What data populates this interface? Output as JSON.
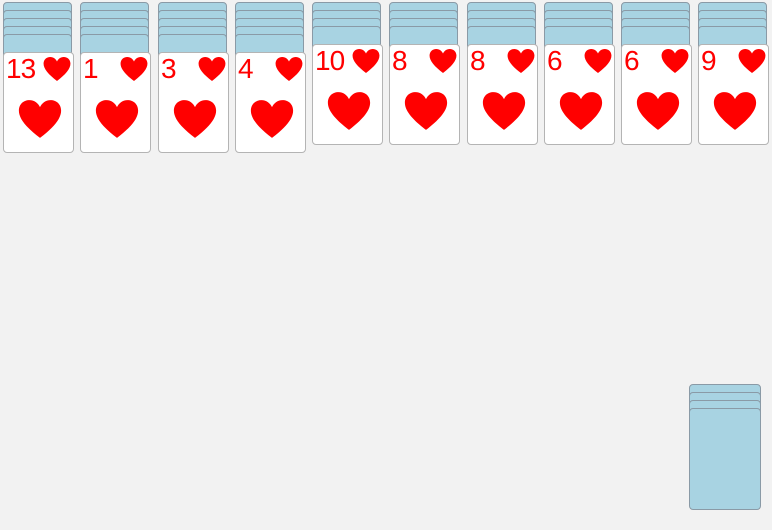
{
  "game": {
    "type": "spider-solitaire",
    "suit_color": "#ff0000",
    "card_back_color": "#a8d3e2",
    "background_color": "#f2f2f2"
  },
  "tableau": [
    {
      "hidden": 5,
      "top": {
        "rank": "13",
        "suit": "heart-icon"
      }
    },
    {
      "hidden": 5,
      "top": {
        "rank": "1",
        "suit": "heart-icon"
      }
    },
    {
      "hidden": 5,
      "top": {
        "rank": "3",
        "suit": "heart-icon"
      }
    },
    {
      "hidden": 5,
      "top": {
        "rank": "4",
        "suit": "heart-icon"
      }
    },
    {
      "hidden": 4,
      "top": {
        "rank": "10",
        "suit": "heart-icon"
      }
    },
    {
      "hidden": 4,
      "top": {
        "rank": "8",
        "suit": "heart-icon"
      }
    },
    {
      "hidden": 4,
      "top": {
        "rank": "8",
        "suit": "heart-icon"
      }
    },
    {
      "hidden": 4,
      "top": {
        "rank": "6",
        "suit": "heart-icon"
      }
    },
    {
      "hidden": 4,
      "top": {
        "rank": "6",
        "suit": "heart-icon"
      }
    },
    {
      "hidden": 4,
      "top": {
        "rank": "9",
        "suit": "heart-icon"
      }
    }
  ],
  "stock": {
    "deals_remaining": 4
  }
}
